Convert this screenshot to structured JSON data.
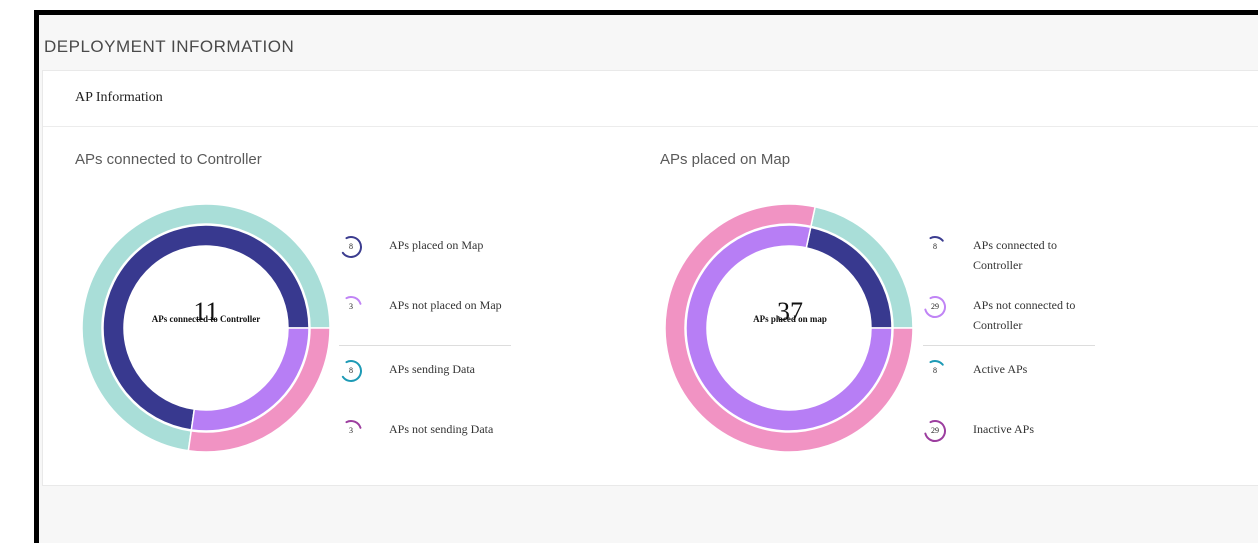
{
  "page": {
    "title": "DEPLOYMENT INFORMATION"
  },
  "card": {
    "title": "AP Information"
  },
  "colors": {
    "teal": "#a9ded8",
    "navy": "#38398f",
    "lavender": "#b77ef5",
    "pink": "#f193c3",
    "badge_navy": "#3b3c8f",
    "badge_lavender": "#c084f5",
    "badge_teal": "#1d9ab5",
    "badge_magenta": "#9c3e9f"
  },
  "controller_panel": {
    "title": "APs connected to Controller",
    "center_value": "11",
    "center_label": "APs connected to Controller",
    "outer_ring": [
      {
        "label": "APs sending Data",
        "value": 8,
        "color": "#a9ded8"
      },
      {
        "label": "APs not sending Data",
        "value": 3,
        "color": "#f193c3"
      }
    ],
    "inner_ring": [
      {
        "label": "APs placed on Map",
        "value": 8,
        "color": "#38398f"
      },
      {
        "label": "APs not placed on Map",
        "value": 3,
        "color": "#b77ef5"
      }
    ],
    "legend": [
      {
        "value": "8",
        "label": "APs placed on Map",
        "icon": "arc-icon",
        "color": "#3b3c8f",
        "fraction": 0.727
      },
      {
        "value": "3",
        "label": "APs not placed on Map",
        "icon": "arc-icon",
        "color": "#c084f5",
        "fraction": 0.273
      },
      {
        "value": "8",
        "label": "APs sending Data",
        "icon": "arc-icon",
        "color": "#1d9ab5",
        "fraction": 0.727
      },
      {
        "value": "3",
        "label": "APs not sending Data",
        "icon": "arc-icon",
        "color": "#9c3e9f",
        "fraction": 0.273
      }
    ]
  },
  "map_panel": {
    "title": "APs placed on Map",
    "center_value": "37",
    "center_label": "APs placed on map",
    "outer_ring": [
      {
        "label": "Active APs",
        "value": 8,
        "color": "#a9ded8"
      },
      {
        "label": "Inactive APs",
        "value": 29,
        "color": "#f193c3"
      }
    ],
    "inner_ring": [
      {
        "label": "APs connected to Controller",
        "value": 8,
        "color": "#38398f"
      },
      {
        "label": "APs not connected to Controller",
        "value": 29,
        "color": "#b77ef5"
      }
    ],
    "legend": [
      {
        "value": "8",
        "label": "APs connected to Controller",
        "icon": "arc-icon",
        "color": "#3b3c8f",
        "fraction": 0.216
      },
      {
        "value": "29",
        "label": "APs not connected to Controller",
        "icon": "arc-icon",
        "color": "#c084f5",
        "fraction": 0.784
      },
      {
        "value": "8",
        "label": "Active APs",
        "icon": "arc-icon",
        "color": "#1d9ab5",
        "fraction": 0.216
      },
      {
        "value": "29",
        "label": "Inactive APs",
        "icon": "arc-icon",
        "color": "#9c3e9f",
        "fraction": 0.784
      }
    ]
  }
}
